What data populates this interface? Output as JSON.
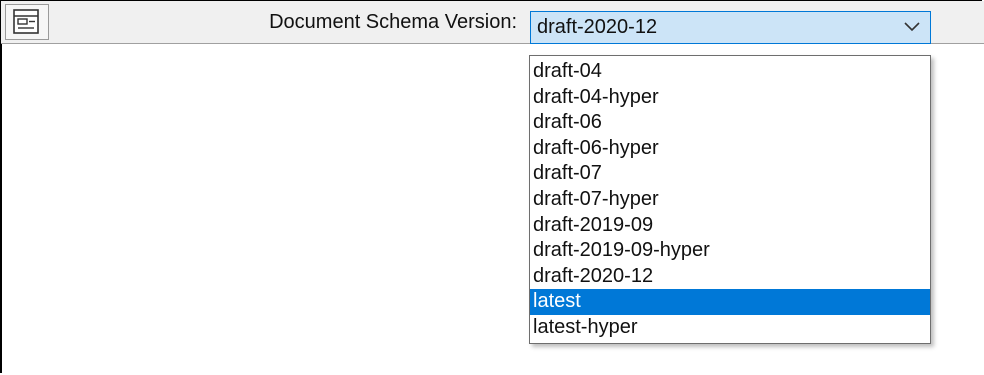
{
  "toolbar": {
    "icon": "form-icon",
    "label": "Document Schema Version:"
  },
  "combo": {
    "selected_value": "draft-2020-12",
    "arrow_icon": "chevron-down-icon",
    "accent_color": "#cce4f7"
  },
  "dropdown": {
    "highlight_color": "#0078d7",
    "highlighted": "latest",
    "options": [
      "draft-04",
      "draft-04-hyper",
      "draft-06",
      "draft-06-hyper",
      "draft-07",
      "draft-07-hyper",
      "draft-2019-09",
      "draft-2019-09-hyper",
      "draft-2020-12",
      "latest",
      "latest-hyper"
    ]
  }
}
